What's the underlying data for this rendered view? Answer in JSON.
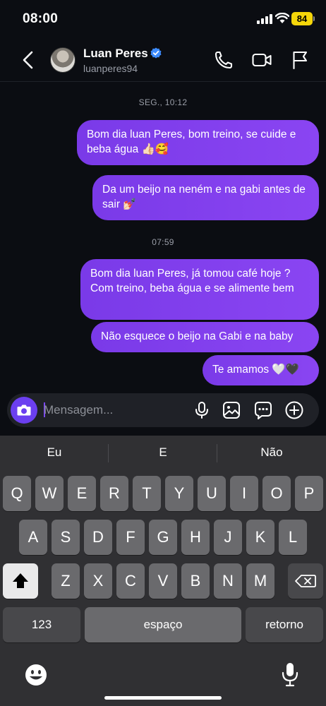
{
  "status_bar": {
    "time": "08:00",
    "battery": "84"
  },
  "header": {
    "name": "Luan Peres",
    "username": "luanperes94"
  },
  "chat": {
    "groups": [
      {
        "timestamp": "SEG., 10:12",
        "messages": [
          "Bom dia luan Peres, bom treino, se cuide e beba água 👍🏻🥰",
          "Da um beijo na neném e na gabi antes de sair 💅🏻"
        ]
      },
      {
        "timestamp": "07:59",
        "messages": [
          "Bom dia luan Peres, já tomou café hoje ? Com treino, beba água e se alimente bem",
          "Não esquece o beijo na Gabi e na baby",
          "Te amamos 🤍🖤"
        ]
      }
    ]
  },
  "composer": {
    "placeholder": "Mensagem...",
    "value": ""
  },
  "keyboard": {
    "suggestions": [
      "Eu",
      "E",
      "Não"
    ],
    "row1": [
      "Q",
      "W",
      "E",
      "R",
      "T",
      "Y",
      "U",
      "I",
      "O",
      "P"
    ],
    "row2": [
      "A",
      "S",
      "D",
      "F",
      "G",
      "H",
      "J",
      "K",
      "L"
    ],
    "row3": [
      "Z",
      "X",
      "C",
      "V",
      "B",
      "N",
      "M"
    ],
    "numbers_label": "123",
    "space_label": "espaço",
    "return_label": "retorno"
  },
  "icons": {
    "back": "chevron-left-icon",
    "verified": "verified-badge-icon",
    "call": "phone-icon",
    "video": "video-camera-icon",
    "report": "flag-icon",
    "camera": "camera-icon",
    "mic": "microphone-icon",
    "gallery": "image-icon",
    "sticker": "chat-dots-icon",
    "add": "plus-circle-icon",
    "emoji": "emoji-icon",
    "dictation": "microphone-icon"
  },
  "colors": {
    "bubble": "#8a45f2",
    "accent": "#6b3ff0",
    "verified": "#3d8bff",
    "battery": "#f5d60a"
  }
}
